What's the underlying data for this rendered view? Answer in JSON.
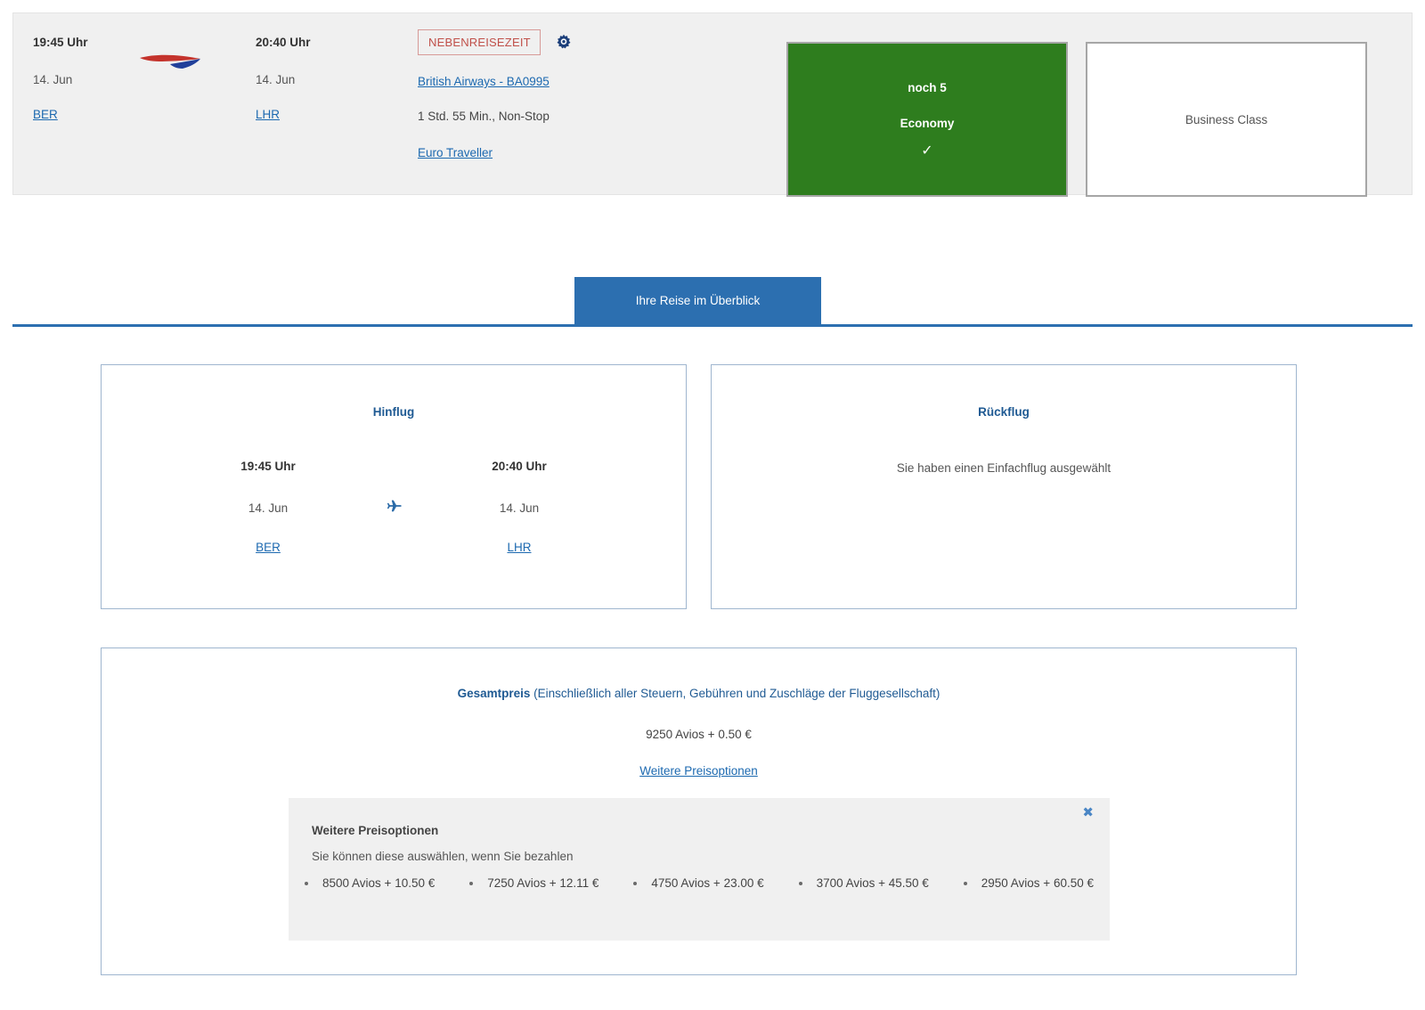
{
  "flight_strip": {
    "depart": {
      "time": "19:45 Uhr",
      "date": "14. Jun",
      "airport": "BER"
    },
    "arrive": {
      "time": "20:40 Uhr",
      "date": "14. Jun",
      "airport": "LHR"
    },
    "airline_logo_name": "british-airways-speedmarque-logo",
    "badge": "NEBENREISEZEIT",
    "settings_icon": "gear-icon",
    "flight_number": "British Airways - BA0995",
    "duration": "1 Std. 55 Min., Non-Stop",
    "cabin_link": "Euro Traveller",
    "fares": [
      {
        "seats": "noch 5",
        "name": "Economy",
        "selected_mark": "✓",
        "selected": true,
        "color": "#2e7d1e"
      },
      {
        "name": "Business Class",
        "selected": false,
        "color": "#ffffff"
      }
    ]
  },
  "tab": {
    "label": "Ihre Reise im Überblick",
    "color": "#2c6fb0"
  },
  "outbound": {
    "title": "Hinflug",
    "depart": {
      "time": "19:45 Uhr",
      "date": "14. Jun",
      "airport": "BER"
    },
    "arrive": {
      "time": "20:40 Uhr",
      "date": "14. Jun",
      "airport": "LHR"
    },
    "plane_icon": "airplane-icon"
  },
  "return": {
    "title": "Rückflug",
    "message": "Sie haben einen Einfachflug ausgewählt"
  },
  "price": {
    "headline_bold": "Gesamtpreis",
    "headline_rest": " (Einschließlich aller Steuern, Gebühren und Zuschläge der Fluggesellschaft)",
    "amount": "9250 Avios + 0.50 €",
    "more_link": "Weitere Preisoptionen",
    "options": {
      "title": "Weitere Preisoptionen",
      "subtitle": "Sie können diese auswählen, wenn Sie bezahlen",
      "close_label": "✖",
      "items": [
        "8500 Avios + 10.50 €",
        "7250 Avios + 12.11 €",
        "4750 Avios + 23.00 €",
        "3700 Avios + 45.50 €",
        "2950 Avios + 60.50 €"
      ]
    }
  },
  "colors": {
    "accent_blue": "#2c6fb0",
    "link_blue": "#1c69b0",
    "heading_blue": "#1f5a93",
    "selected_green": "#2e7d1e",
    "badge_red": "#c0504a",
    "panel_grey": "#f0f0f0"
  }
}
